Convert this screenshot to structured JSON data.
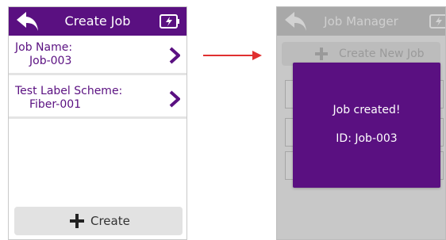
{
  "left_screen": {
    "title": "Create Job",
    "fields": [
      {
        "label": "Job Name:",
        "value": "Job-003"
      },
      {
        "label": "Test Label Scheme:",
        "value": "Fiber-001"
      }
    ],
    "create_button_label": "Create",
    "icons": {
      "back": "back-arrow-icon",
      "battery": "battery-charging-icon",
      "chevron": "chevron-right-icon",
      "plus": "plus-icon"
    }
  },
  "right_screen": {
    "title": "Job Manager",
    "create_button_label": "Create New Job",
    "dialog": {
      "message": "Job created!",
      "id_text": "ID: Job-003"
    }
  },
  "colors": {
    "accent_purple": "#5a1081",
    "arrow_red": "#e03030",
    "dim_overlay": "#c8c8c8"
  }
}
